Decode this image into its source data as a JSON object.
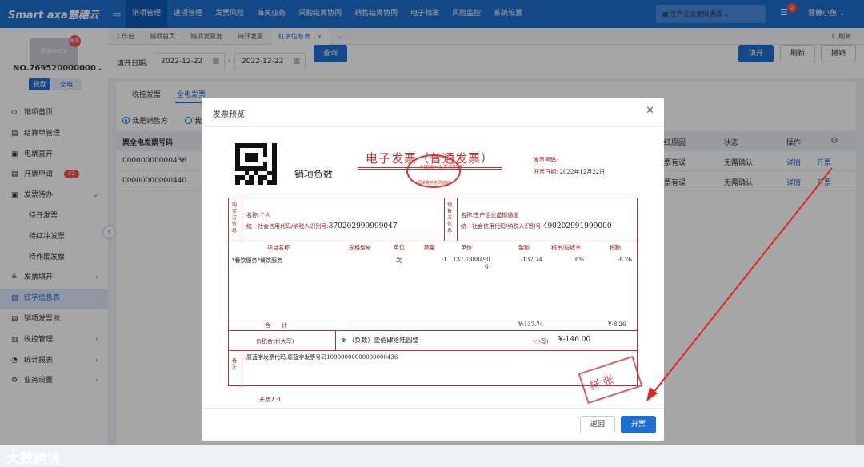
{
  "app": {
    "brand": "Smart axa慧穗云"
  },
  "topnav": {
    "items": [
      "销项管理",
      "进项管理",
      "发票风险",
      "海关业务",
      "采购结算协同",
      "销售结算协同",
      "电子档案",
      "风险监控",
      "系统设置"
    ],
    "active": 0
  },
  "org_selector": "生产企业虚拟通道",
  "notifications": {
    "count": "2"
  },
  "user": {
    "name": "慧穗小鱼"
  },
  "sidebar": {
    "ukey_label": "税务UKEY",
    "ukey_tag": "税务",
    "tax_no": "NO.769520000000",
    "mode_tabs": [
      "税盘",
      "全电"
    ],
    "items": [
      {
        "label": "销项首页",
        "icon": "⊙"
      },
      {
        "label": "结算单管理",
        "icon": "▤"
      },
      {
        "label": "电票直开",
        "icon": "▣"
      },
      {
        "label": "开票申请",
        "icon": "▤",
        "badge": "32"
      },
      {
        "label": "发票待办",
        "icon": "▣",
        "chev": "⌄"
      },
      {
        "label": "待开发票",
        "sub": true
      },
      {
        "label": "待红冲发票",
        "sub": true
      },
      {
        "label": "待作废发票",
        "sub": true
      },
      {
        "label": "发票填开",
        "icon": "≗",
        "chev": "›"
      },
      {
        "label": "红字信息表",
        "icon": "▨",
        "highlight": true
      },
      {
        "label": "销项发票池",
        "icon": "▤"
      },
      {
        "label": "税控管理",
        "icon": "▥",
        "chev": "›"
      },
      {
        "label": "统计报表",
        "icon": "◔",
        "chev": "›"
      },
      {
        "label": "业务设置",
        "icon": "⚙",
        "chev": "›"
      }
    ],
    "watermark": "大数跨境"
  },
  "tabs": {
    "items": [
      "工作台",
      "销项首页",
      "销项发票池",
      "待开发票",
      "红字信息表"
    ],
    "active": 4,
    "refresh": "C 刷新"
  },
  "filter": {
    "label": "填开日期:",
    "from": "2022-12-22",
    "to": "2022-12-22",
    "query": "查询",
    "fill": "填开",
    "refresh": "刷新",
    "revoke": "撤销"
  },
  "content": {
    "subtabs": [
      "税控发票",
      "全电发票"
    ],
    "radios": [
      "我是销售方",
      "我"
    ],
    "header": [
      "票全电发票号码",
      "红原因",
      "状态",
      "操作"
    ],
    "rows": [
      {
        "no": "00000000000436",
        "reason": "票有误",
        "status": "无需确认",
        "detail": "详情",
        "issue": "开票"
      },
      {
        "no": "00000000000440",
        "reason": "票有误",
        "status": "无需确认",
        "detail": "详情",
        "issue": "开票"
      }
    ]
  },
  "dialog": {
    "title": "发票预览",
    "invoice": {
      "type_label": "销项负数",
      "title": "电子发票（普通发票）",
      "stamp_top": "全国统一发票监制章",
      "stamp_bottom": "国家税务总局监制",
      "no_label": "发票号码:",
      "date_label": "开票日期:",
      "date": "2022年12月22日",
      "buyer_side": "购买方信息",
      "buyer_name": "名称:个人",
      "buyer_tax_label": "统一社会信用代码/纳税人识别号:",
      "buyer_tax": "370202999999047",
      "seller_side": "销售方信息",
      "seller_name": "名称:生产企业虚拟通道",
      "seller_tax_label": "统一社会信用代码/纳税人识别号:",
      "seller_tax": "490202991999000",
      "cols": [
        "项目名称",
        "规格型号",
        "单位",
        "数量",
        "单价",
        "金额",
        "税率/征收率",
        "税额"
      ],
      "item": {
        "name": "*餐饮服务*餐饮服务",
        "unit": "次",
        "qty": "-1",
        "price": "137.7388490",
        "price2": "6",
        "amount": "-137.74",
        "rate": "6%",
        "tax": "-8.26"
      },
      "total_label": "合　　计",
      "total_amount": "¥-137.74",
      "total_tax": "¥-8.26",
      "price_tax_label": "价税合计(大写)",
      "price_tax_cn": "（负数）壹佰肆拾陆圆整",
      "small_label": "(小写)",
      "price_tax_num": "¥-146.00",
      "note_side": "备注",
      "note": "原蓝字发票代码,原蓝字发票号码10000000000000000436",
      "issuer": "开票人:1",
      "sample": "样张"
    },
    "back": "返回",
    "issue": "开票"
  }
}
